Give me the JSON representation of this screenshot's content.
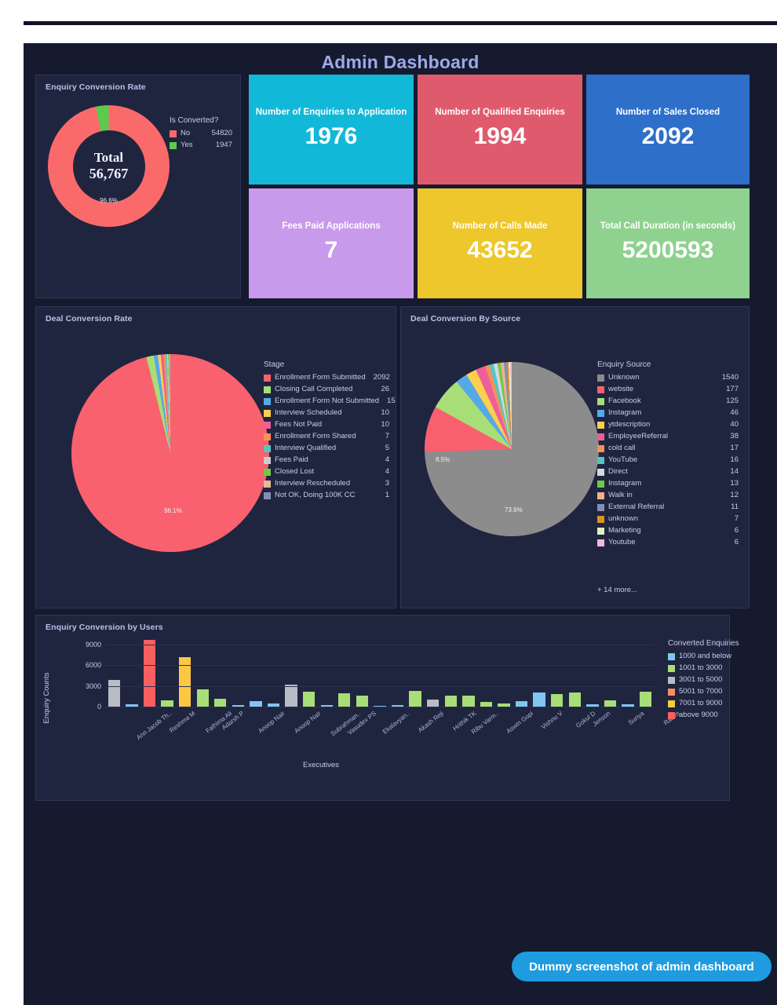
{
  "page": {
    "title": "Admin Dashboard",
    "bg": "#161a2e",
    "panel_bg": "#20253f",
    "title_color": "#9fa8e8"
  },
  "chip": {
    "label": "Dummy screenshot of admin dashboard",
    "color": "#1f9bdf"
  },
  "donut_panel": {
    "title": "Enquiry Conversion Rate",
    "center_label": "Total",
    "center_value": "56,767",
    "slice_pct_label": "96.6%",
    "legend_title": "Is Converted?",
    "items": [
      {
        "label": "No",
        "value": "54820",
        "color": "#fb6a6a"
      },
      {
        "label": "Yes",
        "value": "1947",
        "color": "#5cc94f"
      }
    ]
  },
  "kpis": [
    {
      "label": "Number of Enquiries to Application",
      "value": "1976",
      "color": "#12b8d8"
    },
    {
      "label": "Number of Qualified Enquiries",
      "value": "1994",
      "color": "#e05a6e"
    },
    {
      "label": "Number of Sales Closed",
      "value": "2092",
      "color": "#2d6fc9"
    },
    {
      "label": "Fees Paid Applications",
      "value": "7",
      "color": "#c89aeb"
    },
    {
      "label": "Number of Calls Made",
      "value": "43652",
      "color": "#edc72b"
    },
    {
      "label": "Total Call Duration (in seconds)",
      "value": "5200593",
      "color": "#8fd18f"
    }
  ],
  "deal_panel": {
    "title": "Deal Conversion Rate",
    "legend_title": "Stage",
    "slice_pct_label": "96.1%"
  },
  "source_panel": {
    "title": "Deal Conversion By Source",
    "legend_title": "Enquiry Source",
    "slice_pct_labels": [
      "73.6%",
      "8.5%"
    ],
    "more_label": "+ 14 more..."
  },
  "bars_panel": {
    "title": "Enquiry Conversion by Users",
    "legend_title": "Converted Enquiries",
    "legend": [
      {
        "label": "1000 and below",
        "color": "#7fc6f0"
      },
      {
        "label": "1001 to 3000",
        "color": "#a8de77"
      },
      {
        "label": "3001 to 5000",
        "color": "#b8bcc4"
      },
      {
        "label": "5001 to 7000",
        "color": "#f78f5c"
      },
      {
        "label": "7001 to 9000",
        "color": "#fcc844"
      },
      {
        "label": "above 9000",
        "color": "#f85f5f"
      }
    ]
  },
  "chart_data": [
    {
      "type": "pie",
      "title": "Enquiry Conversion Rate",
      "legend_title": "Is Converted?",
      "legend_position": "right",
      "donut": true,
      "total": 56767,
      "categories": [
        "No",
        "Yes"
      ],
      "values": [
        54820,
        1947
      ],
      "percent_labels": [
        "96.6%",
        "3.4%"
      ],
      "colors": [
        "#fb6a6a",
        "#5cc94f"
      ]
    },
    {
      "type": "pie",
      "title": "Deal Conversion Rate",
      "legend_title": "Stage",
      "legend_position": "right",
      "annotations": [
        "96.1%"
      ],
      "categories": [
        "Enrollment Form Submitted",
        "Closing Call Completed",
        "Enrollment Form Not Submitted",
        "Interview Scheduled",
        "Fees Not Paid",
        "Enrollment Form Shared",
        "Interview Qualified",
        "Fees Paid",
        "Closed Lost",
        "Interview Rescheduled",
        "Not OK, Doing 100K CC"
      ],
      "values": [
        2092,
        26,
        15,
        10,
        10,
        7,
        5,
        4,
        4,
        3,
        1
      ],
      "colors": [
        "#f9616e",
        "#a8de77",
        "#56a9e8",
        "#fccf4d",
        "#ee5f99",
        "#f7905a",
        "#54c6c0",
        "#c9ccd3",
        "#6fca4a",
        "#e7b79a",
        "#8290b8"
      ]
    },
    {
      "type": "pie",
      "title": "Deal Conversion By Source",
      "legend_title": "Enquiry Source",
      "legend_position": "right",
      "annotations": [
        "73.6%",
        "8.5%"
      ],
      "more_label": "+ 14 more...",
      "categories": [
        "Unknown",
        "website",
        "Facebook",
        "Instagram",
        "ytdescription",
        "EmployeeReferral",
        "cold call",
        "YouTube",
        "Direct",
        "Instagram",
        "Walk in",
        "External Referral",
        "unknown",
        "Marketing",
        "Youtube"
      ],
      "values": [
        1540,
        177,
        125,
        46,
        40,
        38,
        17,
        16,
        14,
        13,
        12,
        11,
        7,
        6,
        6
      ],
      "colors": [
        "#8c8c8c",
        "#f9616e",
        "#a8de77",
        "#56a9e8",
        "#fccf4d",
        "#ee5f99",
        "#f7905a",
        "#54c6c0",
        "#d6d8de",
        "#6fca4a",
        "#f0b28d",
        "#8290b8",
        "#d9951f",
        "#dff0c0",
        "#f3b8d8"
      ]
    },
    {
      "type": "bar",
      "title": "Enquiry Conversion by Users",
      "xlabel": "Executives",
      "ylabel": "Enquiry Counts",
      "ylim": [
        0,
        10000
      ],
      "yticks": [
        0,
        3000,
        6000,
        9000
      ],
      "grid": true,
      "legend_title": "Converted Enquiries",
      "legend_position": "right",
      "categories": [
        "Ann Jacob Th..",
        "Reshma M",
        "Fathima Ali",
        "Adarsh P",
        "Anoop Nair",
        "Anoop Nair",
        "Subrahman..",
        "Vasudev PS",
        "Ekalavyan..",
        "Akash Reji",
        "Hrithik TK",
        "Ribu Varm..",
        "Aswin Gopi",
        "Vishnu V",
        "Gokul D",
        "Jenson",
        "Suriya",
        "Rahim"
      ],
      "bar_values": [
        3850,
        300,
        9700,
        950,
        7200,
        2500,
        1150,
        200,
        750,
        500,
        3150,
        2150,
        250,
        1950,
        1550,
        120,
        200,
        2300,
        1050,
        1600,
        1550,
        700,
        480,
        820,
        2000,
        1800,
        2100,
        380,
        950,
        300,
        2200
      ],
      "bar_colors": [
        "#b8bcc4",
        "#7fc6f0",
        "#f85f5f",
        "#a8de77",
        "#fcc844",
        "#a8de77",
        "#a8de77",
        "#7fc6f0",
        "#7fc6f0",
        "#7fc6f0",
        "#b8bcc4",
        "#a8de77",
        "#7fc6f0",
        "#a8de77",
        "#a8de77",
        "#7fc6f0",
        "#7fc6f0",
        "#a8de77",
        "#b8bcc4",
        "#a8de77",
        "#a8de77",
        "#a8de77",
        "#a8de77",
        "#7fc6f0",
        "#7fc6f0",
        "#a8de77",
        "#a8de77",
        "#7fc6f0",
        "#a8de77",
        "#7fc6f0",
        "#a8de77"
      ]
    }
  ],
  "deal_legend": [
    {
      "label": "Enrollment Form Submitted",
      "value": "2092",
      "color": "#f9616e"
    },
    {
      "label": "Closing Call Completed",
      "value": "26",
      "color": "#a8de77"
    },
    {
      "label": "Enrollment Form Not Submitted",
      "value": "15",
      "color": "#56a9e8"
    },
    {
      "label": "Interview Scheduled",
      "value": "10",
      "color": "#fccf4d"
    },
    {
      "label": "Fees Not Paid",
      "value": "10",
      "color": "#ee5f99"
    },
    {
      "label": "Enrollment Form Shared",
      "value": "7",
      "color": "#f7905a"
    },
    {
      "label": "Interview Qualified",
      "value": "5",
      "color": "#54c6c0"
    },
    {
      "label": "Fees Paid",
      "value": "4",
      "color": "#c9ccd3"
    },
    {
      "label": "Closed Lost",
      "value": "4",
      "color": "#6fca4a"
    },
    {
      "label": "Interview Rescheduled",
      "value": "3",
      "color": "#e7b79a"
    },
    {
      "label": "Not OK, Doing 100K CC",
      "value": "1",
      "color": "#8290b8"
    }
  ],
  "source_legend": [
    {
      "label": "Unknown",
      "value": "1540",
      "color": "#8c8c8c"
    },
    {
      "label": "website",
      "value": "177",
      "color": "#f9616e"
    },
    {
      "label": "Facebook",
      "value": "125",
      "color": "#a8de77"
    },
    {
      "label": "Instagram",
      "value": "46",
      "color": "#56a9e8"
    },
    {
      "label": "ytdescription",
      "value": "40",
      "color": "#fccf4d"
    },
    {
      "label": "EmployeeReferral",
      "value": "38",
      "color": "#ee5f99"
    },
    {
      "label": "cold call",
      "value": "17",
      "color": "#f7905a"
    },
    {
      "label": "YouTube",
      "value": "16",
      "color": "#54c6c0"
    },
    {
      "label": "Direct",
      "value": "14",
      "color": "#d6d8de"
    },
    {
      "label": "Instagram",
      "value": "13",
      "color": "#6fca4a"
    },
    {
      "label": "Walk in",
      "value": "12",
      "color": "#f0b28d"
    },
    {
      "label": "External Referral",
      "value": "11",
      "color": "#8290b8"
    },
    {
      "label": "unknown",
      "value": "7",
      "color": "#d9951f"
    },
    {
      "label": "Marketing",
      "value": "6",
      "color": "#dff0c0"
    },
    {
      "label": "Youtube",
      "value": "6",
      "color": "#f3b8d8"
    }
  ]
}
